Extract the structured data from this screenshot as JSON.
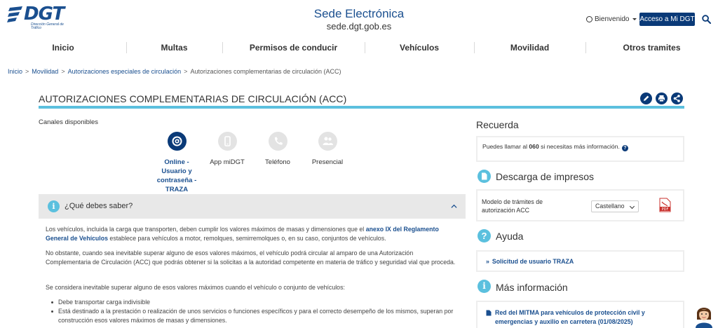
{
  "header": {
    "logo_text": "DGT",
    "logo_subtitle": "Dirección General de Tráfico",
    "site_title": "Sede Electrónica",
    "site_url": "sede.dgt.gob.es",
    "welcome": "Bienvenido",
    "access_button": "Acceso a Mi DGT"
  },
  "nav": {
    "items": [
      "Inicio",
      "Multas",
      "Permisos de conducir",
      "Vehículos",
      "Movilidad",
      "Otros tramites"
    ]
  },
  "breadcrumb": {
    "items": [
      "Inicio",
      "Movilidad",
      "Autorizaciones especiales de circulación"
    ],
    "current": "Autorizaciones complementarias de circulación (ACC)"
  },
  "page": {
    "title": "AUTORIZACIONES COMPLEMENTARIAS DE CIRCULACIÓN (ACC)"
  },
  "channels": {
    "label": "Canales disponibles",
    "items": [
      {
        "label": "Online - Usuario y contraseña - TRAZA",
        "active": true
      },
      {
        "label": "App miDGT",
        "active": false
      },
      {
        "label": "Teléfono",
        "active": false
      },
      {
        "label": "Presencial",
        "active": false
      }
    ]
  },
  "accordion": {
    "title": "¿Qué debes saber?",
    "p1_a": "Los vehículos, incluida la carga que transporten, deben cumplir los valores máximos de masas y dimensiones que el ",
    "p1_link": "anexo IX del Reglamento General de Vehículos",
    "p1_b": " establece para vehículos a motor, remolques, semirremolques o, en su caso, conjuntos de vehículos.",
    "p2": "No obstante, cuando sea inevitable superar alguno de esos valores máximos, el vehículo podrá circular al amparo de una Autorización Complementaria de Circulación (ACC) que podrás obtener si la solicitas a la autoridad competente en materia de tráfico y seguridad vial que proceda.",
    "p3": "Se considera inevitable superar alguno de esos valores máximos cuando el vehículo o conjunto de vehículos:",
    "bullets": [
      "Debe transportar carga indivisible",
      "Está destinado a la prestación o realización de unos servicios o funciones específicos y para el correcto desempeño de los mismos, superan por construcción esos valores máximos de masas y dimensiones."
    ]
  },
  "sidebar": {
    "recuerda": {
      "heading": "Recuerda",
      "text_a": "Puedes llamar al ",
      "number": "060",
      "text_b": " si necesitas más información."
    },
    "descarga": {
      "heading": "Descarga de impresos",
      "model_label": "Modelo de trámites de autorización ACC",
      "language": "Castellano"
    },
    "ayuda": {
      "heading": "Ayuda",
      "link": "Solicitud de usuario TRAZA"
    },
    "mas_info": {
      "heading": "Más información",
      "link": "Red del MITMA para vehículos de protección civil y emergencias y auxilio en carretera (01/08/2025)"
    }
  },
  "colors": {
    "brand_blue": "#0a3a78",
    "link_blue": "#1a4f8f",
    "accent_cyan": "#5bc0de"
  }
}
